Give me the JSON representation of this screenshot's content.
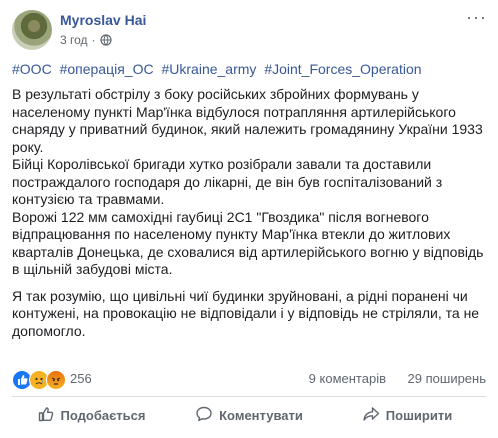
{
  "post": {
    "author": "Myroslav Hai",
    "time": "3 год",
    "time_separator": "·",
    "hashtags": [
      "#ООС",
      "#операція_ОС",
      "#Ukraine_army",
      "#Joint_Forces_Operation"
    ],
    "paragraphs": [
      "В результаті обстрілу з боку російських збройних формувань у населеному пункті Мар'їнка відбулося потрапляння артилерійського снаряду у приватний будинок, який належить громадянину України 1933 року.",
      "Бійці Королівської бригади хутко розібрали завали та доставили постраждалого господаря до лікарні, де він був госпіталізований з контузією та травмами.",
      "Ворожі 122 мм самохідні гаубиці 2С1 \"Гвоздика\" після вогневого відпрацювання по населеному пункту Мар'їнка втекли до житлових кварталів Донецька, де сховалися від артилерійського вогню у відповідь в щільній забудові міста.",
      "Я так розумію, що цивільні чиї будинки зруйновані, а рідні поранені чи контужені, на провокацію не відповідали і у відповідь не стріляли, та не допомогло."
    ]
  },
  "stats": {
    "reactions_count": "256",
    "comments": "9 коментарів",
    "shares": "29 поширень"
  },
  "actions": {
    "like": "Подобається",
    "comment": "Коментувати",
    "share": "Поширити"
  },
  "colors": {
    "link": "#385898",
    "text": "#1c1e21",
    "muted": "#606770",
    "like_blue": "#1877f2"
  },
  "icons": [
    "globe-icon",
    "more-icon",
    "like-reaction-icon",
    "sad-reaction-icon",
    "angry-reaction-icon",
    "thumbs-up-icon",
    "comment-icon",
    "share-icon"
  ]
}
